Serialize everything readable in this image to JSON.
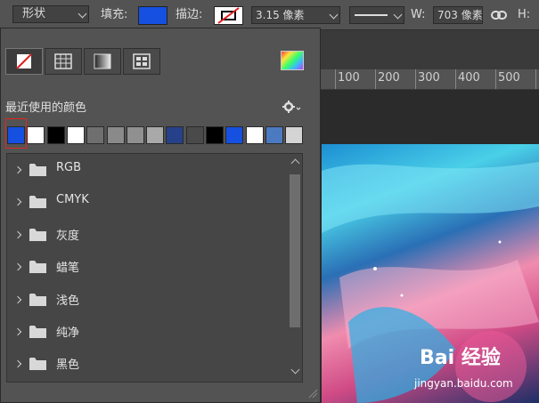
{
  "optionbar": {
    "mode_value": "形状",
    "fill_label": "填充:",
    "fill_color": "#1550e0",
    "stroke_label": "描边:",
    "stroke_width": "3.15 像素",
    "w_label": "W:",
    "w_value": "703 像素",
    "h_label": "H:"
  },
  "ruler": {
    "ticks": [
      "100",
      "200",
      "300",
      "400",
      "500"
    ]
  },
  "panel": {
    "mode_buttons": [
      "no-color-icon",
      "solid-grid-icon",
      "gradient-icon",
      "pattern-icon"
    ],
    "recent_title": "最近使用的颜色",
    "recent_colors": [
      "#1550e0",
      "#ffffff",
      "#000000",
      "#ffffff",
      "#6f6f6f",
      "#8a8a8a",
      "#909090",
      "#a9a9a9",
      "#26418a",
      "#4a4a4a",
      "#000000",
      "#1550e0",
      "#ffffff",
      "#4b7ac0",
      "#d4d4d4"
    ],
    "folders": [
      "RGB",
      "CMYK",
      "灰度",
      "蜡笔",
      "浅色",
      "纯净",
      "黑色"
    ]
  },
  "watermark": {
    "brand": "Bai 经验",
    "url": "jingyan.baidu.com"
  }
}
